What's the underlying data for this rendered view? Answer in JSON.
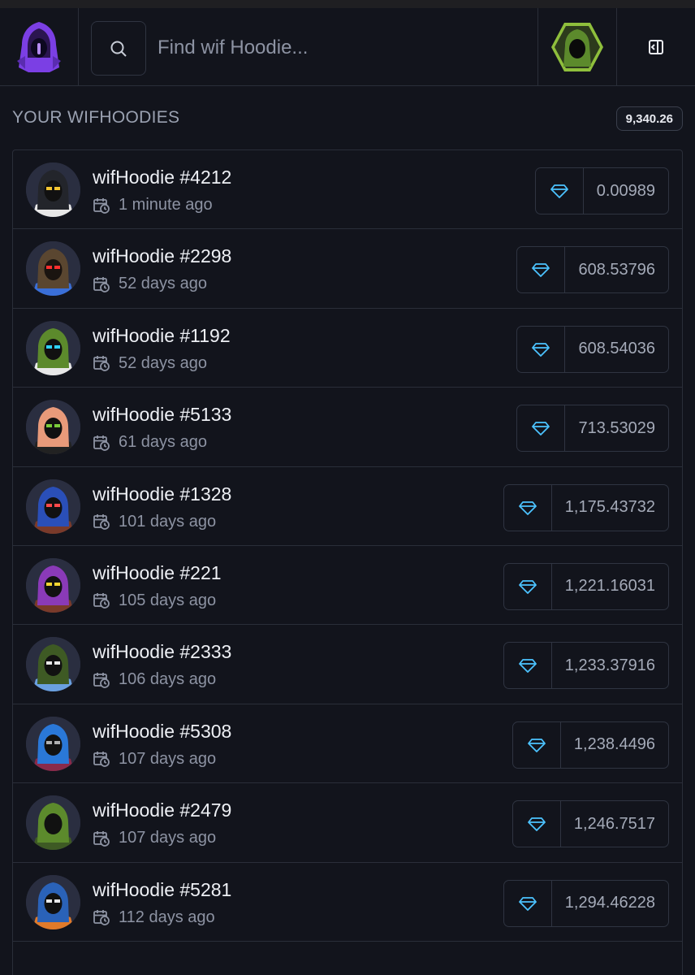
{
  "header": {
    "search_placeholder": "Find wif Hoodie...",
    "logo_icon": "hooded-figure-logo",
    "profile_icon": "green-hoodie-avatar",
    "panel_icon": "sidebar-toggle-icon"
  },
  "section": {
    "title": "YOUR WIFHOODIES",
    "total": "9,340.26"
  },
  "colors": {
    "background": "#12141c",
    "border": "#2a2e39",
    "gem": "#4cc3ff",
    "accent_purple": "#7b3fe4",
    "accent_green": "#8fbf3c"
  },
  "items": [
    {
      "name": "wifHoodie #4212",
      "time": "1 minute ago",
      "price": "0.00989",
      "hood": "#23252b",
      "face": "#111",
      "eyes": "#f4c531",
      "accent": "#e8e8e8"
    },
    {
      "name": "wifHoodie #2298",
      "time": "52 days ago",
      "price": "608.53796",
      "hood": "#5a4630",
      "face": "#1a1410",
      "eyes": "#ff3030",
      "accent": "#3a6fd8"
    },
    {
      "name": "wifHoodie #1192",
      "time": "52 days ago",
      "price": "608.54036",
      "hood": "#5c8a2c",
      "face": "#111",
      "eyes": "#2fd3ff",
      "accent": "#e8e8e8"
    },
    {
      "name": "wifHoodie #5133",
      "time": "61 days ago",
      "price": "713.53029",
      "hood": "#e89a7a",
      "face": "#111",
      "eyes": "#7acc3a",
      "accent": "#222"
    },
    {
      "name": "wifHoodie #1328",
      "time": "101 days ago",
      "price": "1,175.43732",
      "hood": "#2a4fb8",
      "face": "#111",
      "eyes": "#ff4a4a",
      "accent": "#7a3a2a"
    },
    {
      "name": "wifHoodie #221",
      "time": "105 days ago",
      "price": "1,221.16031",
      "hood": "#8a3ab8",
      "face": "#111",
      "eyes": "#f4d531",
      "accent": "#7a3a2a"
    },
    {
      "name": "wifHoodie #2333",
      "time": "106 days ago",
      "price": "1,233.37916",
      "hood": "#3e5a24",
      "face": "#111",
      "eyes": "#e8e8e8",
      "accent": "#6aa0e0"
    },
    {
      "name": "wifHoodie #5308",
      "time": "107 days ago",
      "price": "1,238.4496",
      "hood": "#2a78d8",
      "face": "#111",
      "eyes": "#b0b0b0",
      "accent": "#8a2a4a"
    },
    {
      "name": "wifHoodie #2479",
      "time": "107 days ago",
      "price": "1,246.7517",
      "hood": "#5c8a2c",
      "face": "#111",
      "eyes": "#111",
      "accent": "#3e5a24"
    },
    {
      "name": "wifHoodie #5281",
      "time": "112 days ago",
      "price": "1,294.46228",
      "hood": "#2a62b8",
      "face": "#111",
      "eyes": "#e8e8e8",
      "accent": "#e07a2a"
    }
  ]
}
